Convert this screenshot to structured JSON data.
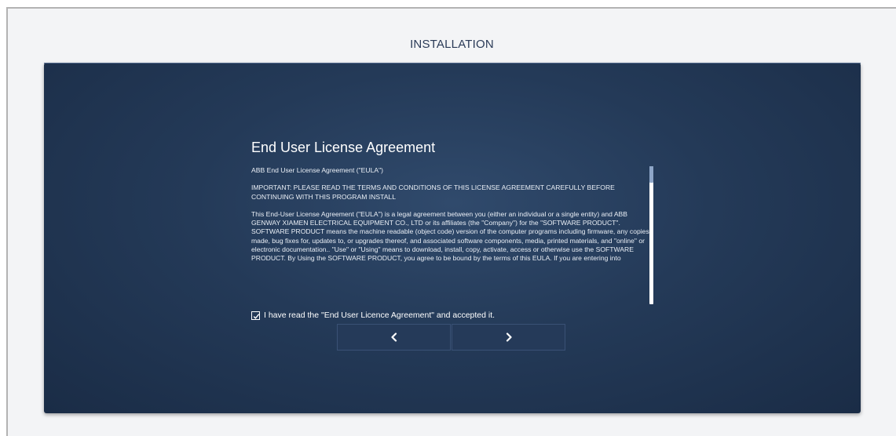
{
  "page": {
    "title": "INSTALLATION"
  },
  "eula": {
    "heading": "End User License Agreement",
    "paragraphs": [
      "ABB End User License Agreement (\"EULA\")",
      "IMPORTANT: PLEASE READ THE TERMS AND CONDITIONS OF THIS LICENSE AGREEMENT CAREFULLY BEFORE CONTINUING WITH THIS PROGRAM INSTALL",
      "This End-User License Agreement (\"EULA\") is a legal agreement between you (either an individual or a single entity) and ABB GENWAY XIAMEN ELECTRICAL EQUIPMENT CO., LTD or its affiliates (the \"Company\") for the \"SOFTWARE PRODUCT\". SOFTWARE PRODUCT means the machine readable (object code) version of the computer programs including firmware, any copies made, bug fixes for, updates to, or upgrades thereof, and associated software components, media, printed materials, and \"online\" or electronic documentation.. \"Use\" or \"Using\" means to download, install, copy, activate, access or otherwise use the SOFTWARE PRODUCT. By Using the SOFTWARE PRODUCT, you agree to be bound by the terms of this EULA. If you are entering into"
    ],
    "accept_label": "I have read the \"End User Licence Agreement\" and accepted it.",
    "accepted": true
  },
  "navigation": {
    "back_icon": "chevron-left-icon",
    "next_icon": "chevron-right-icon"
  },
  "colors": {
    "panel": "#243a58",
    "title_text": "#2a3a57",
    "button": "#253a59"
  }
}
